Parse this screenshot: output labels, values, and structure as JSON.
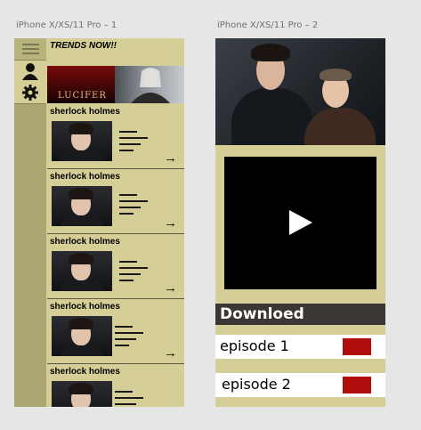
{
  "artboards": {
    "one_title": "iPhone X/XS/11 Pro – 1",
    "two_title": "iPhone X/XS/11 Pro – 2"
  },
  "screen1": {
    "rail_icons": [
      "hamburger-icon",
      "user-icon",
      "gear-icon"
    ],
    "trends_label": "TRENDS NOW!!",
    "posters": [
      {
        "name": "lucifer-poster",
        "text": "LUCIFER"
      },
      {
        "name": "witcher-poster"
      }
    ],
    "rows": [
      {
        "title": "sherlock holmes"
      },
      {
        "title": "sherlock holmes"
      },
      {
        "title": "sherlock holmes"
      },
      {
        "title": "sherlock holmes"
      },
      {
        "title": "sherlock holmes"
      }
    ],
    "arrow_glyph": "→"
  },
  "screen2": {
    "download_label": "Downloed",
    "episodes": [
      {
        "label": "episode 1"
      },
      {
        "label": "episode 2"
      }
    ]
  },
  "colors": {
    "background": "#e6e6e6",
    "panel": "#d5ce97",
    "rail": "#a9a672",
    "accent_red": "#b00d0d",
    "download_bar": "#3b3533"
  }
}
